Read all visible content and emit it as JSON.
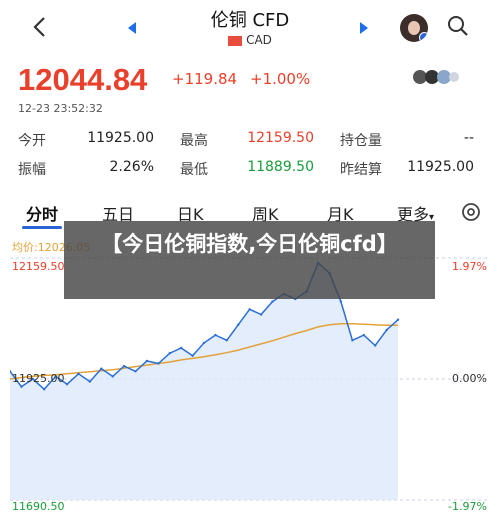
{
  "header": {
    "title": "伦铜 CFD",
    "subtitle": "CAD"
  },
  "quote": {
    "price": "12044.84",
    "change": "+119.84",
    "change_pct": "+1.00%",
    "timestamp": "12-23 23:52:32"
  },
  "stats": [
    {
      "label": "今开",
      "value": "11925.00",
      "color": "#222222"
    },
    {
      "label": "最高",
      "value": "12159.50",
      "color": "#e8402b"
    },
    {
      "label": "持仓量",
      "value": "--",
      "color": "#222222"
    },
    {
      "label": "振幅",
      "value": "2.26%",
      "color": "#222222"
    },
    {
      "label": "最低",
      "value": "11889.50",
      "color": "#1a9c3a"
    },
    {
      "label": "昨结算",
      "value": "11925.00",
      "color": "#222222"
    }
  ],
  "tabs": [
    "分时",
    "五日",
    "日K",
    "周K",
    "月K",
    "更多"
  ],
  "banner": "【今日伦铜指数,今日伦铜cfd】",
  "chart": {
    "avg_label": "均价:12026.05",
    "y_top_label": "12159.50",
    "y_mid_label": "11925.00",
    "y_bottom_label": "11690.50",
    "pct_top_label": "1.97%",
    "pct_mid_label": "0.00%",
    "pct_bottom_label": "-1.97%"
  },
  "chart_data": {
    "type": "line",
    "title": "",
    "ylim": [
      11690.5,
      12159.5
    ],
    "reference_line": 11925.0,
    "series": [
      {
        "name": "",
        "values": [
          11940,
          11910,
          11925,
          11905,
          11930,
          11915,
          11935,
          11920,
          11945,
          11930,
          11950,
          11940,
          11960,
          11955,
          11975,
          11985,
          11970,
          11995,
          12010,
          12000,
          12030,
          12060,
          12050,
          12075,
          12090,
          12080,
          12095,
          12150,
          12130,
          12075,
          12000,
          12010,
          11990,
          12020,
          12040
        ]
      },
      {
        "name": "均价",
        "values": [
          11925,
          11928,
          11930,
          11932,
          11933,
          11935,
          11937,
          11939,
          11941,
          11943,
          11946,
          11949,
          11952,
          11955,
          11958,
          11962,
          11965,
          11968,
          11972,
          11976,
          11981,
          11987,
          11993,
          11999,
          12006,
          12013,
          12019,
          12026,
          12030,
          12032,
          12032,
          12031,
          12030,
          12029,
          12029
        ]
      }
    ],
    "colors": {
      "price": "#2b6fd6",
      "avg": "#e4a13a",
      "fill": "#dce8fb"
    }
  }
}
